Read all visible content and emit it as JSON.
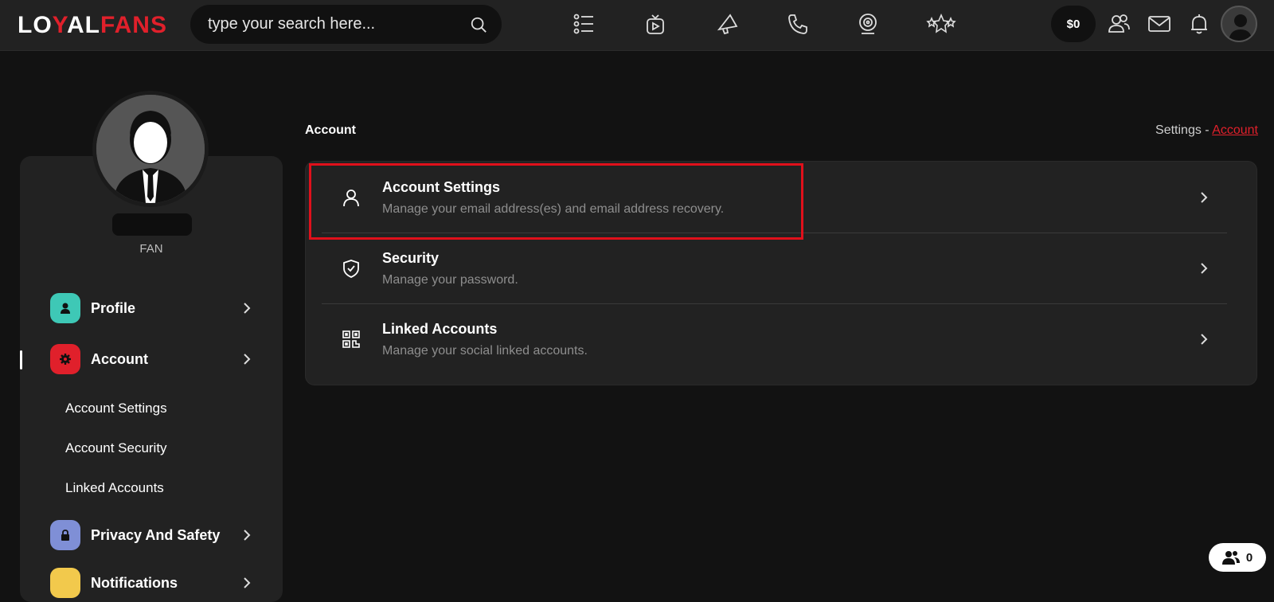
{
  "brand": {
    "logo_part1": "LO",
    "logo_part2": "Y",
    "logo_part3": "AL",
    "logo_part4": "FANS"
  },
  "search": {
    "placeholder": "type your search here..."
  },
  "nav_icons": [
    "list-icon",
    "video-icon",
    "megaphone-icon",
    "phone-icon",
    "webcam-icon",
    "stars-icon"
  ],
  "header": {
    "balance": "$0"
  },
  "profile": {
    "role": "FAN"
  },
  "sidebar": {
    "items": [
      {
        "label": "Profile",
        "color": "#3ec8b6"
      },
      {
        "label": "Account",
        "color": "#e0202b"
      },
      {
        "label": "Privacy And Safety",
        "color": "#7f8fd6"
      },
      {
        "label": "Notifications",
        "color": "#f2c94c"
      }
    ],
    "account_submenu": [
      "Account Settings",
      "Account Security",
      "Linked Accounts"
    ]
  },
  "main": {
    "heading": "Account",
    "breadcrumb": {
      "root": "Settings",
      "sep": " - ",
      "current": "Account"
    },
    "rows": [
      {
        "title": "Account Settings",
        "desc": "Manage your email address(es) and email address recovery."
      },
      {
        "title": "Security",
        "desc": "Manage your password."
      },
      {
        "title": "Linked Accounts",
        "desc": "Manage your social linked accounts."
      }
    ]
  },
  "online": {
    "count": "0"
  }
}
